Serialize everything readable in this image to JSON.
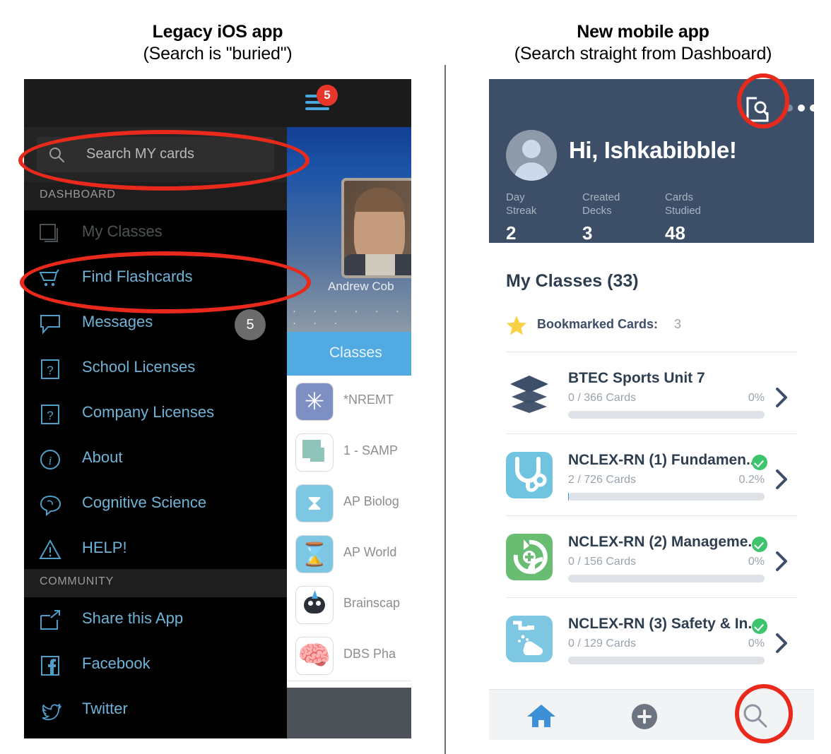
{
  "captions": {
    "left": {
      "title": "Legacy iOS app",
      "subtitle": "(Search is \"buried\")"
    },
    "right": {
      "title": "New mobile app",
      "subtitle": "(Search straight from Dashboard)"
    }
  },
  "legacy_app": {
    "status_badge": "5",
    "hamburger_icon": "hamburger-menu-icon",
    "search": {
      "placeholder": "Search MY cards",
      "icon": "search-icon"
    },
    "sections": [
      {
        "label": "DASHBOARD"
      },
      {
        "label": "COMMUNITY"
      }
    ],
    "dashboard_items": [
      {
        "label": "My Classes",
        "icon": "cards-stack-icon",
        "badge": "",
        "dim": true
      },
      {
        "label": "Find Flashcards",
        "icon": "shopping-cart-icon",
        "badge": "",
        "dim": false
      },
      {
        "label": "Messages",
        "icon": "speech-bubble-icon",
        "badge": "5",
        "dim": false
      },
      {
        "label": "School Licenses",
        "icon": "question-box-icon",
        "badge": "",
        "dim": false
      },
      {
        "label": "Company Licenses",
        "icon": "question-box-icon",
        "badge": "",
        "dim": false
      },
      {
        "label": "About",
        "icon": "info-circle-icon",
        "badge": "",
        "dim": false
      },
      {
        "label": "Cognitive Science",
        "icon": "brain-bubble-icon",
        "badge": "",
        "dim": false
      },
      {
        "label": "HELP!",
        "icon": "warning-triangle-icon",
        "badge": "",
        "dim": false
      }
    ],
    "community_items": [
      {
        "label": "Share this App",
        "icon": "share-box-icon",
        "badge": "",
        "dim": false
      },
      {
        "label": "Facebook",
        "icon": "facebook-icon",
        "badge": "",
        "dim": false
      },
      {
        "label": "Twitter",
        "icon": "twitter-bird-icon",
        "badge": "",
        "dim": false
      }
    ],
    "background": {
      "user_name": "Andrew Cob",
      "dots": "· · · · · · · · ·",
      "tab_label": "Classes",
      "rows": [
        {
          "label": "*NREMT",
          "icon": "medical-star-icon"
        },
        {
          "label": "1 - SAMP",
          "icon": "cards-stack-green-icon"
        },
        {
          "label": "AP Biolog",
          "icon": "dna-icon"
        },
        {
          "label": "AP World",
          "icon": "hourglass-icon"
        },
        {
          "label": "Brainscap",
          "icon": "brainscape-mascot-icon"
        },
        {
          "label": "DBS Pha",
          "icon": "brain-icon"
        }
      ]
    }
  },
  "new_app": {
    "header": {
      "doc_search_icon": "document-search-icon",
      "more_icon": "more-dots-icon",
      "avatar_icon": "user-avatar-icon",
      "greeting": "Hi, Ishkabibble!",
      "stats": [
        {
          "label_line1": "Day",
          "label_line2": "Streak",
          "value": "2"
        },
        {
          "label_line1": "Created",
          "label_line2": "Decks",
          "value": "3"
        },
        {
          "label_line1": "Cards",
          "label_line2": "Studied",
          "value": "48"
        }
      ]
    },
    "section_title": "My Classes (33)",
    "bookmark": {
      "icon": "star-icon",
      "label": "Bookmarked Cards:",
      "count": "3"
    },
    "classes": [
      {
        "title": "BTEC Sports Unit 7",
        "cards": "0 / 366 Cards",
        "percent": "0%",
        "progress": 0,
        "verified": false,
        "icon": "layers-stack-icon",
        "icon_color": "#ffffff"
      },
      {
        "title": "NCLEX-RN (1) Fundamen...",
        "cards": "2 / 726 Cards",
        "percent": "0.2%",
        "progress": 0.2,
        "verified": true,
        "icon": "stethoscope-icon",
        "icon_color": "#71c4e0"
      },
      {
        "title": "NCLEX-RN (2) Manageme...",
        "cards": "0 / 156 Cards",
        "percent": "0%",
        "progress": 0,
        "verified": true,
        "icon": "recycle-plus-icon",
        "icon_color": "#68bd72"
      },
      {
        "title": "NCLEX-RN (3) Safety & In...",
        "cards": "0 / 129 Cards",
        "percent": "0%",
        "progress": 0,
        "verified": true,
        "icon": "handwashing-icon",
        "icon_color": "#7ec7e2"
      }
    ],
    "tabbar": [
      {
        "icon": "home-icon",
        "name": "tab-home"
      },
      {
        "icon": "plus-circle-icon",
        "name": "tab-add"
      },
      {
        "icon": "search-icon",
        "name": "tab-search"
      }
    ]
  },
  "annotations": {
    "colors": {
      "highlight": "#e8291c",
      "accent_blue": "#3d8fd6",
      "header_navy": "#3d4e68"
    },
    "items": [
      {
        "name": "search-bar-highlight",
        "shape": "ellipse"
      },
      {
        "name": "find-flashcards-highlight",
        "shape": "ellipse"
      },
      {
        "name": "doc-search-highlight",
        "shape": "circle"
      },
      {
        "name": "tab-search-highlight",
        "shape": "circle"
      }
    ]
  }
}
